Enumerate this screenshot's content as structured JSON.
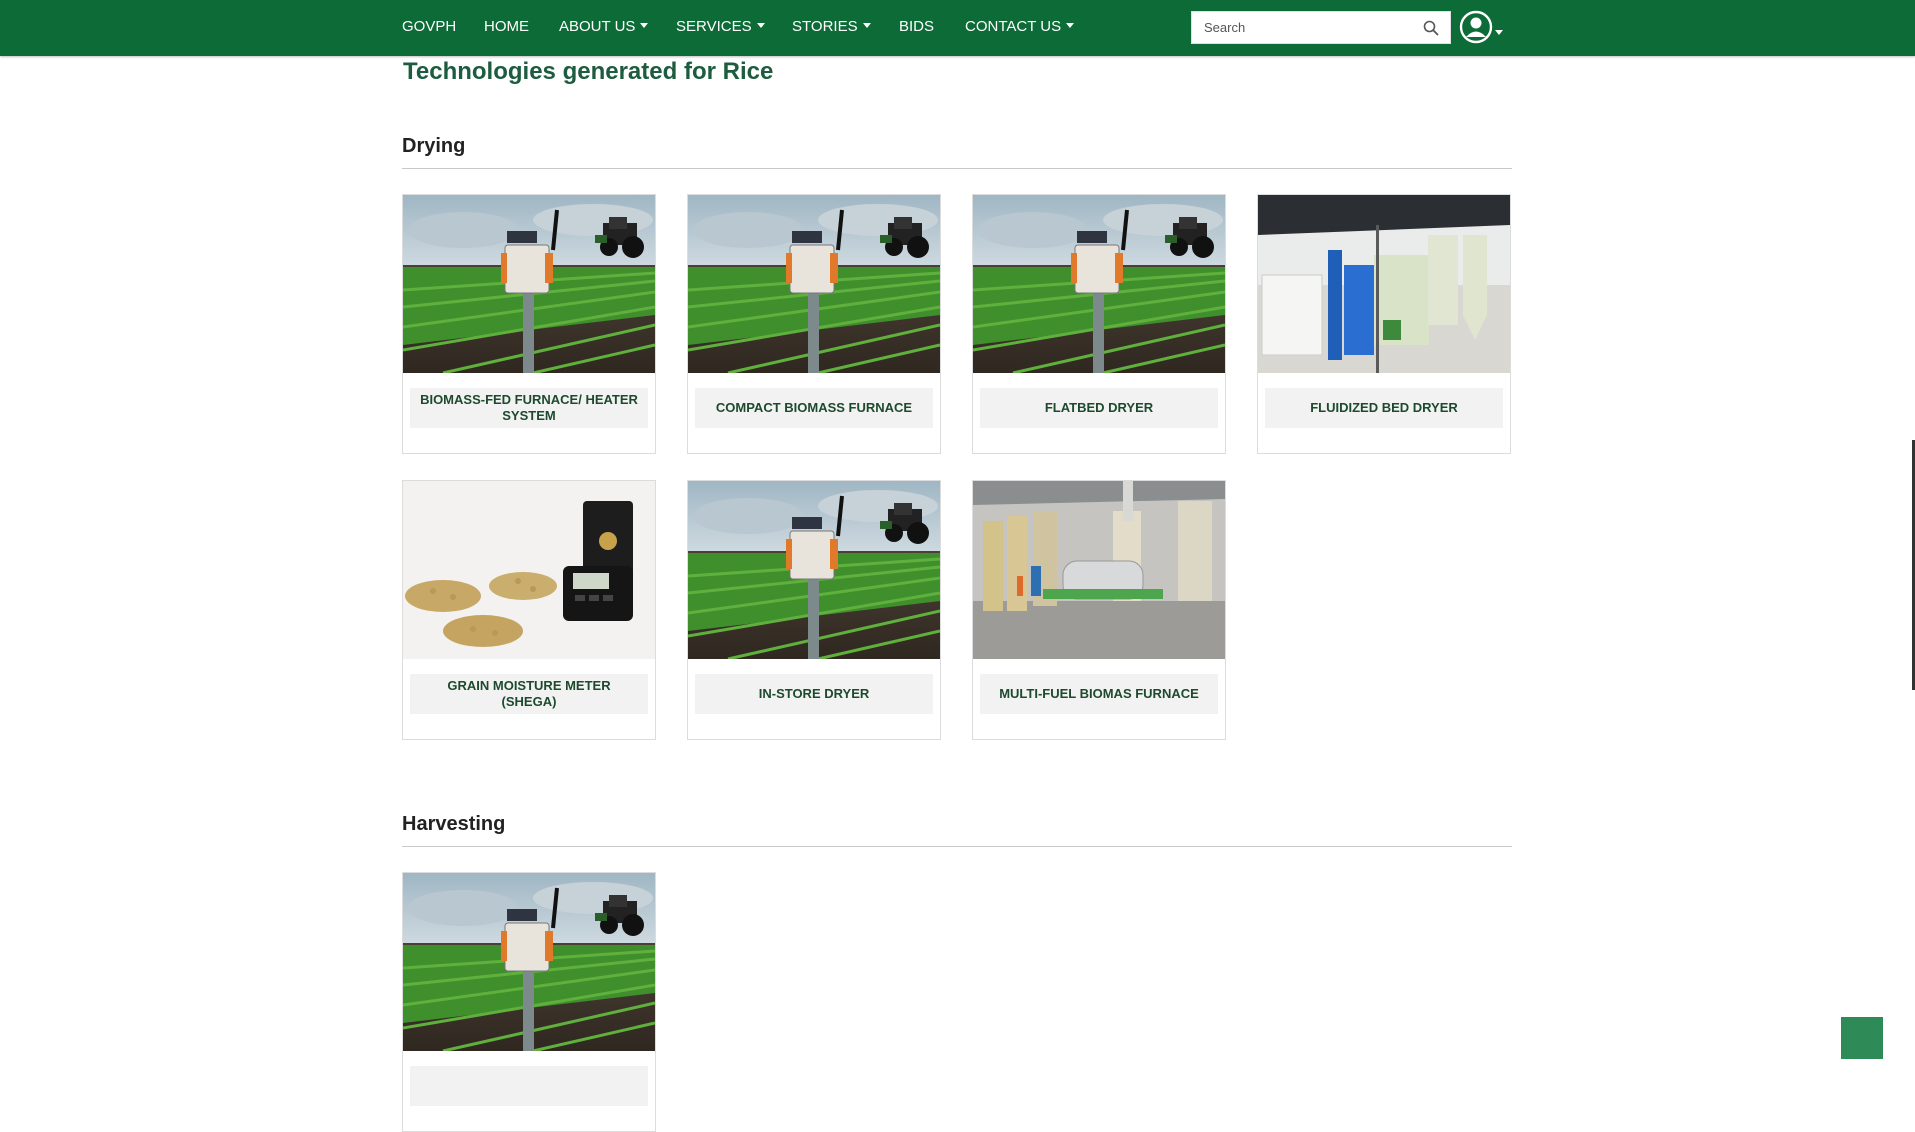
{
  "nav": {
    "brand": "GOVPH",
    "home": "HOME",
    "about": "ABOUT US",
    "services": "SERVICES",
    "stories": "STORIES",
    "bids": "BIDS",
    "contact": "CONTACT US",
    "search_placeholder": "Search"
  },
  "page": {
    "title": "Technologies generated for Rice"
  },
  "sections": [
    {
      "title": "Drying",
      "cards": [
        {
          "label": "BIOMASS-FED FURNACE/ HEATER SYSTEM",
          "image": "field-sensor"
        },
        {
          "label": "COMPACT BIOMASS FURNACE",
          "image": "field-sensor"
        },
        {
          "label": "FLATBED DRYER",
          "image": "field-sensor"
        },
        {
          "label": "FLUIDIZED BED DRYER",
          "image": "dryer-plant"
        },
        {
          "label": "GRAIN MOISTURE METER (SHEGA)",
          "image": "moisture-meter"
        },
        {
          "label": "IN-STORE DRYER",
          "image": "field-sensor"
        },
        {
          "label": "MULTI-FUEL BIOMAS FURNACE",
          "image": "warehouse-furnace"
        }
      ]
    },
    {
      "title": "Harvesting",
      "cards": [
        {
          "label": "",
          "image": "field-sensor"
        }
      ]
    }
  ],
  "colors": {
    "navbar": "#0c6b36",
    "title": "#1d5c3e",
    "card_label": "#1d4a2d",
    "back_to_top": "#2e8b57"
  }
}
